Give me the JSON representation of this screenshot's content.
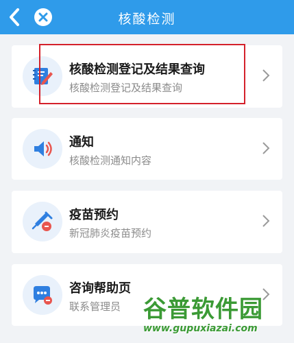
{
  "header": {
    "title": "核酸检测",
    "back_icon": "chevron-left-icon",
    "close_icon": "close-icon",
    "background": "#2f9bea"
  },
  "items": [
    {
      "title": "核酸检测登记及结果查询",
      "subtitle": "核酸检测登记及结果查询",
      "icon": "edit-notebook-icon"
    },
    {
      "title": "通知",
      "subtitle": "核酸检测通知内容",
      "icon": "speaker-icon"
    },
    {
      "title": "疫苗预约",
      "subtitle": "新冠肺炎疫苗预约",
      "icon": "vaccine-syringe-icon"
    },
    {
      "title": "咨询帮助页",
      "subtitle": "联系管理员",
      "icon": "chat-bubble-icon"
    }
  ],
  "annotation": {
    "color": "#d4202a"
  },
  "watermark": {
    "main": "谷普软件园",
    "url": "www.gupuxiazai.com"
  }
}
